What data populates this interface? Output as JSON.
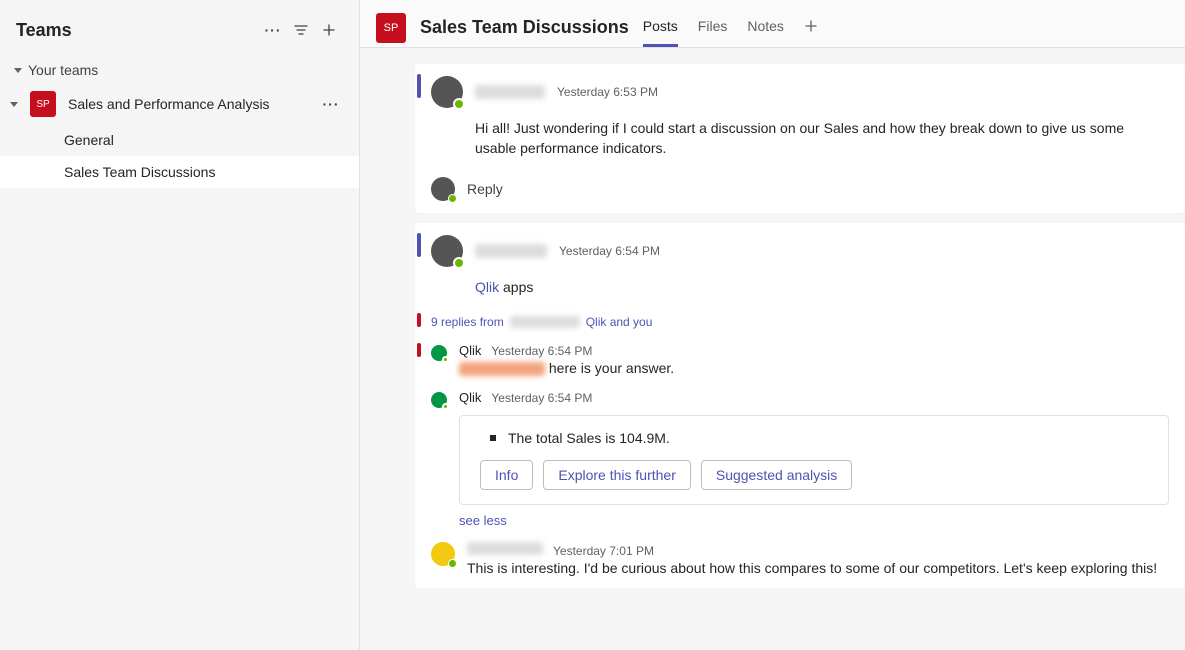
{
  "sidebar": {
    "title": "Teams",
    "section_label": "Your teams",
    "team": {
      "initials": "SP",
      "name": "Sales and Performance Analysis"
    },
    "channels": [
      {
        "label": "General",
        "active": false
      },
      {
        "label": "Sales Team Discussions",
        "active": true
      }
    ]
  },
  "header": {
    "avatar_initials": "SP",
    "title": "Sales Team Discussions",
    "tabs": [
      {
        "label": "Posts",
        "active": true
      },
      {
        "label": "Files",
        "active": false
      },
      {
        "label": "Notes",
        "active": false
      }
    ]
  },
  "posts": [
    {
      "time": "Yesterday 6:53 PM",
      "body": "Hi all! Just wondering if I could start a discussion on our Sales and how they break down to give us some usable performance indicators."
    },
    {
      "time": "Yesterday 6:54 PM",
      "body_prefix": "Qlik",
      "body_suffix": " apps",
      "thread": {
        "summary_prefix": "9 replies from ",
        "summary_suffix": "Qlik and you",
        "replies": [
          {
            "author": "Qlik",
            "time": "Yesterday 6:54 PM",
            "text_suffix": " here is your answer.",
            "marked": true
          },
          {
            "author": "Qlik",
            "time": "Yesterday 6:54 PM",
            "card": {
              "bullet_text": "The total Sales is 104.9M.",
              "actions": [
                "Info",
                "Explore this further",
                "Suggested analysis"
              ]
            },
            "see_less": "see less"
          },
          {
            "avatar_color": "yellow",
            "time": "Yesterday 7:01 PM",
            "text": "This is interesting. I'd be curious about how this compares to some of our competitors. Let's keep exploring this!"
          }
        ]
      }
    }
  ],
  "labels": {
    "reply": "Reply"
  }
}
